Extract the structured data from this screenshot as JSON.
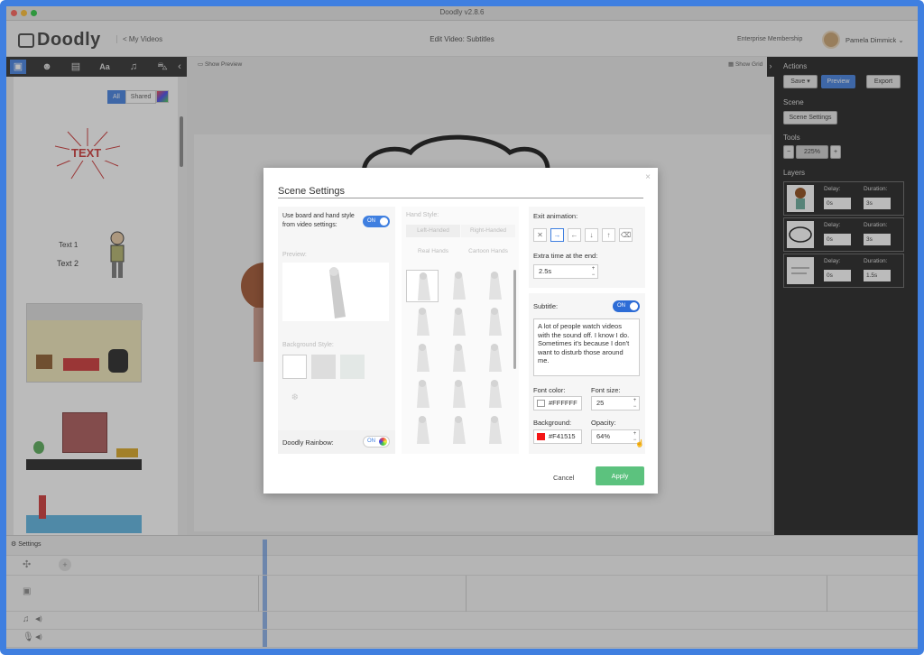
{
  "window": {
    "title": "Doodly v2.8.6"
  },
  "header": {
    "logo": "Doodly",
    "back_link": "< My Videos",
    "page_title": "Edit Video: Subtitles",
    "membership": "Enterprise Membership",
    "user_name": "Pamela Dimmick"
  },
  "toolbar": {
    "icons": [
      "image-icon",
      "people-icon",
      "props-icon",
      "text-icon",
      "music-icon",
      "cart-icon",
      "collapse-icon"
    ]
  },
  "library": {
    "tabs": [
      "All",
      "Shared"
    ],
    "items": [
      "TEXT",
      "Text 1",
      "Text 2"
    ]
  },
  "canvas": {
    "show_preview": "Show Preview",
    "show_grid": "Show Grid"
  },
  "right_panel": {
    "actions_title": "Actions",
    "save": "Save",
    "preview": "Preview",
    "export": "Export",
    "scene_title": "Scene",
    "scene_settings": "Scene Settings",
    "tools_title": "Tools",
    "zoom": "225%",
    "layers_title": "Layers",
    "layers": [
      {
        "delay_label": "Delay:",
        "delay": "0s",
        "duration_label": "Duration:",
        "duration": "3s"
      },
      {
        "delay_label": "Delay:",
        "delay": "0s",
        "duration_label": "Duration:",
        "duration": "3s"
      },
      {
        "delay_label": "Delay:",
        "delay": "0s",
        "duration_label": "Duration:",
        "duration": "1.5s"
      }
    ]
  },
  "timeline": {
    "settings": "Settings"
  },
  "modal": {
    "title": "Scene Settings",
    "board_hand_label": "Use board and hand style from video settings:",
    "toggle_on": "ON",
    "preview_label": "Preview:",
    "background_style_label": "Background Style:",
    "doodly_rainbow": "Doodly Rainbow:",
    "hand_style_label": "Hand Style:",
    "left_handed": "Left-Handed",
    "right_handed": "Right-Handed",
    "real_hands": "Real Hands",
    "cartoon_hands": "Cartoon Hands",
    "exit_animation_label": "Exit animation:",
    "extra_time_label": "Extra time at the end:",
    "extra_time": "2.5s",
    "subtitle_label": "Subtitle:",
    "subtitle_text": "A lot of people watch videos with the sound off. I know I do. Sometimes it's because I don't want to disturb those around me.",
    "font_color_label": "Font color:",
    "font_color": "#FFFFFF",
    "font_size_label": "Font size:",
    "font_size": "25",
    "background_label": "Background:",
    "background_color": "#F41515",
    "opacity_label": "Opacity:",
    "opacity": "64%",
    "cancel": "Cancel",
    "apply": "Apply"
  },
  "colors": {
    "accent": "#3f7fe0",
    "apply": "#5cc27e",
    "subtitle_bg": "#F41515"
  }
}
